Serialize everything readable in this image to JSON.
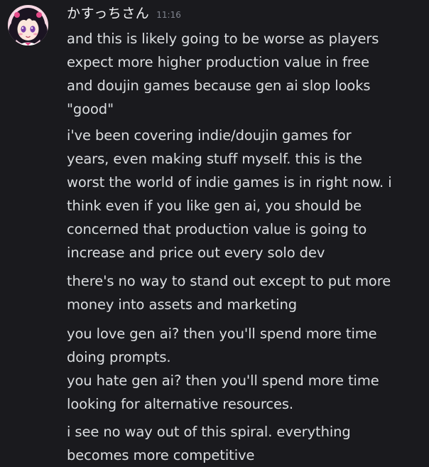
{
  "author": {
    "name": "かすっちさん",
    "timestamp": "11:16",
    "avatar_icon": "anime-girl-avatar-icon"
  },
  "colors": {
    "background": "#1a1a1e",
    "text": "#dbdee1",
    "username": "#f2f3f5",
    "timestamp": "#80848e"
  },
  "messages": [
    "and this is likely going to be worse as players\nexpect more higher production value in free\nand doujin games because gen ai slop looks\n\"good\"",
    "i've been covering indie/doujin games for\nyears, even making stuff myself. this is the\nworst the world of indie games is in right now. i\nthink even if you like gen ai, you should be\nconcerned that production value is going to\nincrease and price out every solo dev",
    "there's no way to stand out except to put more\nmoney into assets and marketing",
    "you love gen ai? then you'll spend more time\ndoing prompts.",
    "you hate gen ai? then you'll spend more time\nlooking for alternative resources.",
    "i see no way out of this spiral. everything\nbecomes more competitive"
  ]
}
